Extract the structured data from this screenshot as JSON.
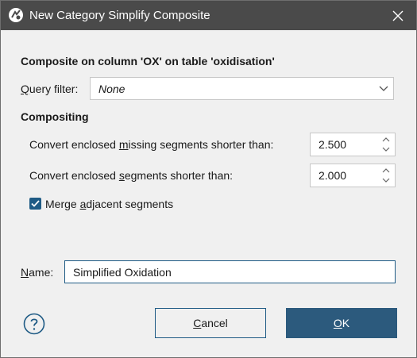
{
  "window": {
    "title": "New Category Simplify Composite",
    "icon": "app-logo-icon",
    "close_icon": "close-icon"
  },
  "header": {
    "composite_description": "Composite on column 'OX' on table 'oxidisation'"
  },
  "query_filter": {
    "label_pre": "",
    "label_accel": "Q",
    "label_post": "uery filter:",
    "value": "None"
  },
  "compositing": {
    "section_title": "Compositing",
    "missing_segments": {
      "label_pre": "Convert enclosed ",
      "label_accel": "m",
      "label_post": "issing segments shorter than:",
      "value": "2.500"
    },
    "segments": {
      "label_pre": "Convert enclosed ",
      "label_accel": "s",
      "label_post": "egments shorter than:",
      "value": "2.000"
    },
    "merge_adjacent": {
      "label_pre": "Merge ",
      "label_accel": "a",
      "label_post": "djacent segments",
      "checked": true
    }
  },
  "name_field": {
    "label_pre": "",
    "label_accel": "N",
    "label_post": "ame:",
    "value": "Simplified Oxidation"
  },
  "buttons": {
    "help_icon": "help-icon",
    "cancel_pre": "",
    "cancel_accel": "C",
    "cancel_post": "ancel",
    "ok_pre": "",
    "ok_accel": "O",
    "ok_post": "K"
  },
  "colors": {
    "titlebar": "#4a4a4a",
    "accent": "#1f5b85",
    "ok_button": "#2c5a7d",
    "dialog_bg": "#f0f0f0"
  }
}
